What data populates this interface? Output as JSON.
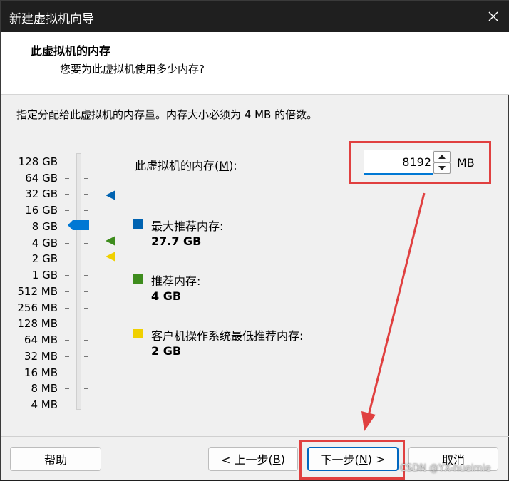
{
  "window": {
    "title": "新建虚拟机向导"
  },
  "header": {
    "title": "此虚拟机的内存",
    "subtitle": "您要为此虚拟机使用多少内存?"
  },
  "instruction": "指定分配给此虚拟机的内存量。内存大小必须为 4 MB 的倍数。",
  "scale": {
    "labels": [
      "128 GB",
      "64 GB",
      "32 GB",
      "16 GB",
      "8 GB",
      "4 GB",
      "2 GB",
      "1 GB",
      "512 MB",
      "256 MB",
      "128 MB",
      "64 MB",
      "32 MB",
      "16 MB",
      "8 MB",
      "4 MB"
    ],
    "selected": "8 GB"
  },
  "memory": {
    "label_prefix": "此虚拟机的内存(",
    "label_key": "M",
    "label_suffix": "):",
    "value": "8192",
    "unit": "MB"
  },
  "legend": {
    "max": {
      "title": "最大推荐内存:",
      "value": "27.7 GB",
      "color": "#0063b1"
    },
    "recommended": {
      "title": "推荐内存:",
      "value": "4 GB",
      "color": "#3e8c1d"
    },
    "minimum": {
      "title": "客户机操作系统最低推荐内存:",
      "value": "2 GB",
      "color": "#f0d000"
    }
  },
  "buttons": {
    "help": "帮助",
    "back_prefix": "< 上一步(",
    "back_key": "B",
    "back_suffix": ")",
    "next_prefix": "下一步(",
    "next_key": "N",
    "next_suffix": ") >",
    "cancel": "取消"
  },
  "annotation_color": "#e04040",
  "watermark": "CSDN @YX-hueimie"
}
